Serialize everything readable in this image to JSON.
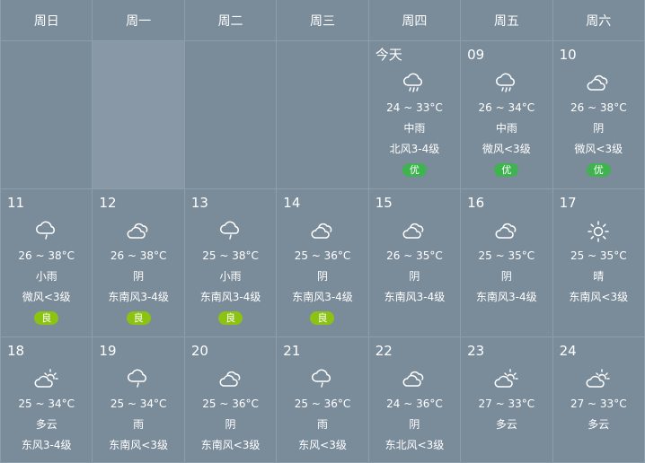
{
  "weekdays": [
    "周日",
    "周一",
    "周二",
    "周三",
    "周四",
    "周五",
    "周六"
  ],
  "colors": {
    "background": "#7a8b9a",
    "highlight_cell": "#8898a6",
    "aqi_good": "#3fb34f",
    "aqi_moderate": "#8cc313"
  },
  "weeks": [
    [
      {
        "empty": true
      },
      {
        "empty": true,
        "highlight": true
      },
      {
        "empty": true
      },
      {
        "empty": true
      },
      {
        "date": "今天",
        "icon": "rain-cloud-icon",
        "temp": "24 ~ 33°C",
        "desc": "中雨",
        "wind": "北风3-4级",
        "aqi": "优"
      },
      {
        "date": "09",
        "icon": "rain-cloud-icon",
        "temp": "26 ~ 34°C",
        "desc": "中雨",
        "wind": "微风<3级",
        "aqi": "优"
      },
      {
        "date": "10",
        "icon": "overcast-icon",
        "temp": "26 ~ 38°C",
        "desc": "阴",
        "wind": "微风<3级",
        "aqi": "优"
      }
    ],
    [
      {
        "date": "11",
        "icon": "light-rain-icon",
        "temp": "26 ~ 38°C",
        "desc": "小雨",
        "wind": "微风<3级",
        "aqi": "良"
      },
      {
        "date": "12",
        "icon": "overcast-icon",
        "temp": "26 ~ 38°C",
        "desc": "阴",
        "wind": "东南风3-4级",
        "aqi": "良"
      },
      {
        "date": "13",
        "icon": "light-rain-icon",
        "temp": "25 ~ 38°C",
        "desc": "小雨",
        "wind": "东南风3-4级",
        "aqi": "良"
      },
      {
        "date": "14",
        "icon": "overcast-icon",
        "temp": "25 ~ 36°C",
        "desc": "阴",
        "wind": "东南风3-4级",
        "aqi": "良"
      },
      {
        "date": "15",
        "icon": "overcast-icon",
        "temp": "26 ~ 35°C",
        "desc": "阴",
        "wind": "东南风3-4级"
      },
      {
        "date": "16",
        "icon": "overcast-icon",
        "temp": "25 ~ 35°C",
        "desc": "阴",
        "wind": "东南风3-4级"
      },
      {
        "date": "17",
        "icon": "sun-icon",
        "temp": "25 ~ 35°C",
        "desc": "晴",
        "wind": "东南风<3级"
      }
    ],
    [
      {
        "date": "18",
        "icon": "partly-cloudy-icon",
        "temp": "25 ~ 34°C",
        "desc": "多云",
        "wind": "东风3-4级"
      },
      {
        "date": "19",
        "icon": "light-rain-icon",
        "temp": "25 ~ 34°C",
        "desc": "雨",
        "wind": "东南风<3级"
      },
      {
        "date": "20",
        "icon": "overcast-icon",
        "temp": "25 ~ 36°C",
        "desc": "阴",
        "wind": "东南风<3级"
      },
      {
        "date": "21",
        "icon": "light-rain-icon",
        "temp": "25 ~ 36°C",
        "desc": "雨",
        "wind": "东风<3级"
      },
      {
        "date": "22",
        "icon": "overcast-icon",
        "temp": "24 ~ 36°C",
        "desc": "阴",
        "wind": "东北风<3级"
      },
      {
        "date": "23",
        "icon": "partly-cloudy-icon",
        "temp": "27 ~ 33°C",
        "desc": "多云"
      },
      {
        "date": "24",
        "icon": "partly-cloudy-icon",
        "temp": "27 ~ 33°C",
        "desc": "多云"
      }
    ]
  ]
}
